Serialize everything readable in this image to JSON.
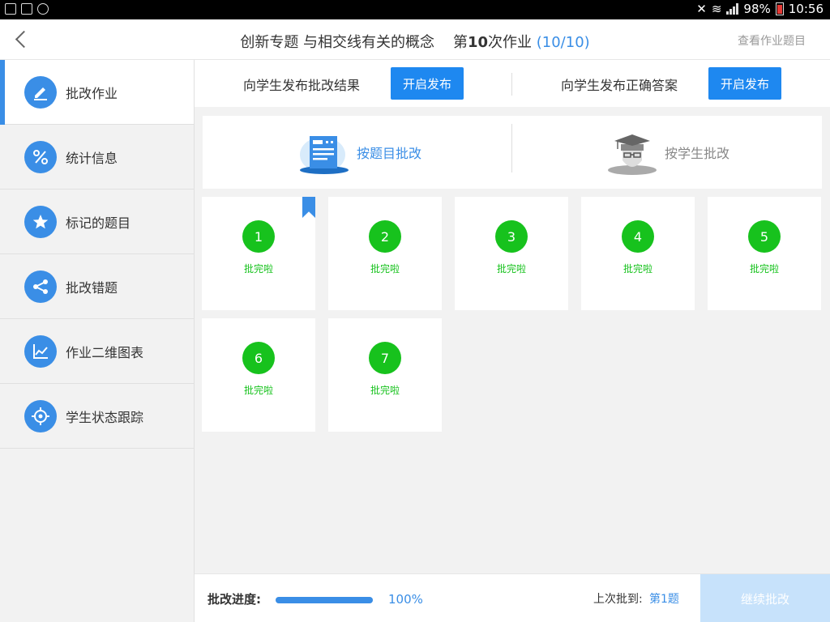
{
  "statusbar": {
    "battery": "98%",
    "time": "10:56"
  },
  "header": {
    "title": "创新专题 与相交线有关的概念",
    "homework_prefix": "第",
    "homework_num": "10",
    "homework_suffix": "次作业",
    "count": "(10/10)",
    "view_questions": "查看作业题目"
  },
  "sidebar": {
    "items": [
      {
        "label": "批改作业",
        "icon": "pencil-icon"
      },
      {
        "label": "统计信息",
        "icon": "percent-icon"
      },
      {
        "label": "标记的题目",
        "icon": "star-icon"
      },
      {
        "label": "批改错题",
        "icon": "share-icon"
      },
      {
        "label": "作业二维图表",
        "icon": "line-chart-icon"
      },
      {
        "label": "学生状态跟踪",
        "icon": "target-icon"
      }
    ]
  },
  "publish": {
    "results_label": "向学生发布批改结果",
    "results_button": "开启发布",
    "answers_label": "向学生发布正确答案",
    "answers_button": "开启发布"
  },
  "modes": {
    "by_question": "按题目批改",
    "by_student": "按学生批改"
  },
  "questions": [
    {
      "num": "1",
      "status": "批完啦",
      "bookmarked": true
    },
    {
      "num": "2",
      "status": "批完啦"
    },
    {
      "num": "3",
      "status": "批完啦"
    },
    {
      "num": "4",
      "status": "批完啦"
    },
    {
      "num": "5",
      "status": "批完啦"
    },
    {
      "num": "6",
      "status": "批完啦"
    },
    {
      "num": "7",
      "status": "批完啦"
    }
  ],
  "bottom": {
    "progress_label": "批改进度:",
    "progress_fraction": 1.0,
    "progress_value": "100%",
    "last_label": "上次批到:",
    "last_value": "第1题",
    "continue_button": "继续批改"
  },
  "colors": {
    "accent": "#3a8ee6",
    "button": "#1e88f0",
    "done_green": "#17c21d",
    "continue_disabled": "#c7e2fb"
  }
}
